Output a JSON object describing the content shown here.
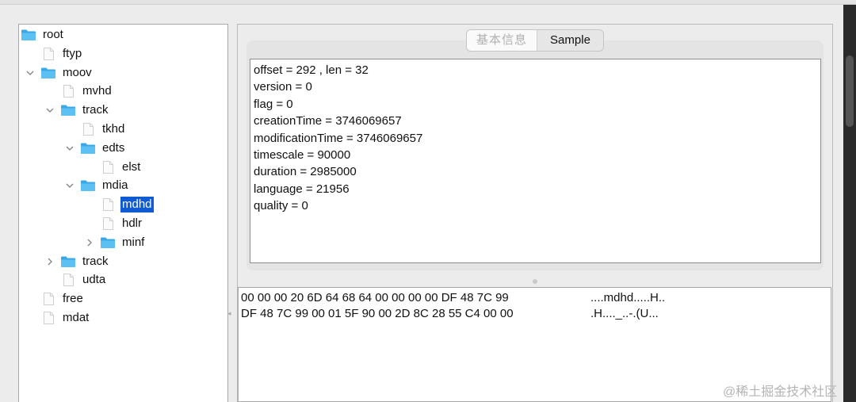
{
  "tree": {
    "nodes": [
      {
        "label": "root",
        "type": "folder",
        "expand": "none",
        "depth": 0
      },
      {
        "label": "ftyp",
        "type": "file",
        "expand": "none",
        "depth": 1
      },
      {
        "label": "moov",
        "type": "folder",
        "expand": "open",
        "depth": 1
      },
      {
        "label": "mvhd",
        "type": "file",
        "expand": "none",
        "depth": 2
      },
      {
        "label": "track",
        "type": "folder",
        "expand": "open",
        "depth": 2
      },
      {
        "label": "tkhd",
        "type": "file",
        "expand": "none",
        "depth": 3
      },
      {
        "label": "edts",
        "type": "folder",
        "expand": "open",
        "depth": 3
      },
      {
        "label": "elst",
        "type": "file",
        "expand": "none",
        "depth": 4
      },
      {
        "label": "mdia",
        "type": "folder",
        "expand": "open",
        "depth": 3
      },
      {
        "label": "mdhd",
        "type": "file",
        "expand": "none",
        "depth": 4,
        "selected": true
      },
      {
        "label": "hdlr",
        "type": "file",
        "expand": "none",
        "depth": 4
      },
      {
        "label": "minf",
        "type": "folder",
        "expand": "closed",
        "depth": 4
      },
      {
        "label": "track",
        "type": "folder",
        "expand": "closed",
        "depth": 2
      },
      {
        "label": "udta",
        "type": "file",
        "expand": "none",
        "depth": 2
      },
      {
        "label": "free",
        "type": "file",
        "expand": "none",
        "depth": 1
      },
      {
        "label": "mdat",
        "type": "file",
        "expand": "none",
        "depth": 1
      }
    ]
  },
  "tabs": {
    "basic_info": "基本信息",
    "sample": "Sample"
  },
  "info": {
    "lines": [
      "offset = 292 , len = 32",
      "version = 0",
      "flag = 0",
      "creationTime = 3746069657",
      "modificationTime = 3746069657",
      "timescale = 90000",
      "duration = 2985000",
      "language = 21956",
      "quality = 0"
    ]
  },
  "hex": {
    "rows": [
      {
        "hex": "00 00 00 20 6D 64 68 64 00 00 00 00 DF 48 7C 99",
        "ascii": "....mdhd.....H.."
      },
      {
        "hex": "DF 48 7C 99 00 01 5F 90 00 2D 8C 28 55 C4 00 00",
        "ascii": ".H...._..-.(U..."
      }
    ]
  },
  "watermark": "@稀土掘金技术社区",
  "colors": {
    "folder": "#3aa8e8",
    "selection": "#0f5bd3"
  }
}
